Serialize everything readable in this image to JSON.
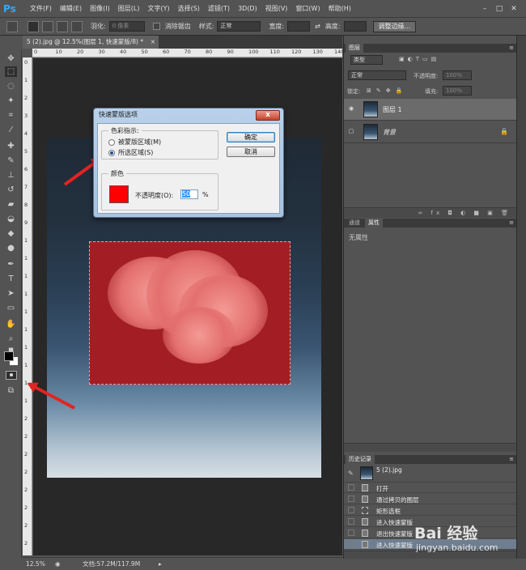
{
  "app": {
    "logo": "Ps"
  },
  "menu": [
    "文件(F)",
    "编辑(E)",
    "图像(I)",
    "图层(L)",
    "文字(Y)",
    "选择(S)",
    "滤镜(T)",
    "3D(D)",
    "视图(V)",
    "窗口(W)",
    "帮助(H)"
  ],
  "options_bar": {
    "feather_label": "羽化:",
    "feather_value": "0 像素",
    "antialias_label": "消除锯齿",
    "style_label": "样式:",
    "style_value": "正常",
    "width_label": "宽度:",
    "height_label": "高度:",
    "refine_button": "调整边缘..."
  },
  "document": {
    "tab_title": "5 (2).jpg @ 12.5%(图层 1, 快速蒙版/8) *",
    "tab_close": "×",
    "ruler_top": [
      "0",
      "10",
      "20",
      "30",
      "40",
      "50",
      "60",
      "70",
      "80",
      "90",
      "100",
      "110",
      "120",
      "130",
      "140"
    ],
    "ruler_left": [
      "0",
      "1",
      "2",
      "3",
      "4",
      "5",
      "6",
      "7",
      "8",
      "9",
      "1",
      "1",
      "1",
      "1",
      "1",
      "1",
      "1",
      "1",
      "1",
      "1",
      "2",
      "2",
      "2",
      "2",
      "2",
      "2",
      "2",
      "2"
    ]
  },
  "dialog": {
    "title": "快速蒙版选项",
    "close": "x",
    "group_color_indicates": "色彩指示:",
    "radio_masked": "被蒙版区域(M)",
    "radio_selected": "所选区域(S)",
    "selected_option": "selected",
    "group_color": "颜色",
    "opacity_label": "不透明度(O):",
    "opacity_value": "50",
    "opacity_unit": "%",
    "ok_button": "确定",
    "cancel_button": "取消",
    "mask_color": "#ff0000"
  },
  "layers_panel": {
    "tab": "图层",
    "filter_value": "类型",
    "blend_mode": "正常",
    "opacity_label": "不透明度:",
    "opacity_value": "100%",
    "lock_label": "锁定:",
    "fill_label": "填充:",
    "fill_value": "100%",
    "layers": [
      {
        "name": "图层 1",
        "selected": true,
        "visible": true
      },
      {
        "name": "背景",
        "selected": false,
        "visible": false,
        "locked": true
      }
    ],
    "footer_icons": "∞ fx ◘ ◐ ■ ▣ 🗑"
  },
  "properties_panel": {
    "tabs": [
      "通道",
      "属性"
    ],
    "active_tab": "属性",
    "content": "无属性"
  },
  "history_panel": {
    "tab": "历史记录",
    "snapshot": "5 (2).jpg",
    "items": [
      "打开",
      "通过拷贝的图层",
      "矩形选框",
      "进入快速蒙版",
      "退出快速蒙版",
      "进入快速蒙版"
    ],
    "selected_index": 5
  },
  "status_bar": {
    "zoom": "12.5%",
    "doc_info": "文档:57.2M/117.9M"
  },
  "watermark": {
    "brand": "Bai 经验",
    "url": "jingyan.baidu.com"
  }
}
